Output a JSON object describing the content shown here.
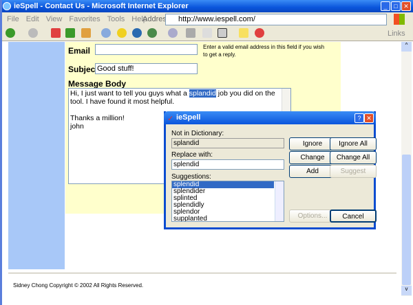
{
  "window": {
    "title": "ieSpell - Contact Us - Microsoft Internet Explorer"
  },
  "menu": [
    "File",
    "Edit",
    "View",
    "Favorites",
    "Tools",
    "Help"
  ],
  "address": {
    "label": "Address",
    "url": "http://www.iespell.com/"
  },
  "links_label": "Links",
  "form": {
    "email_label": "Email",
    "email_value": "",
    "email_hint": "Enter a valid email address in this field if you wish to get a reply.",
    "subject_label": "Subject",
    "subject_value": "Good stuff!",
    "body_label": "Message Body",
    "body_before": "Hi, I just want to tell you guys what a ",
    "body_highlight": "splandid",
    "body_after": " job you did on the tool. I have found it most helpful.",
    "body_line3": "Thanks a million!",
    "body_line4": "john"
  },
  "footer": "Sidney Chong Copyright © 2002 All Rights Reserved.",
  "dialog": {
    "title": "ieSpell",
    "not_in_dict_label": "Not in Dictionary:",
    "not_in_dict_value": "splandid",
    "replace_label": "Replace with:",
    "replace_value": "splendid",
    "suggestions_label": "Suggestions:",
    "suggestions": [
      "splendid",
      "splendider",
      "splinted",
      "splendidly",
      "splendor",
      "supplanted"
    ],
    "selected": "splendid",
    "buttons": {
      "ignore": "Ignore",
      "ignore_all": "Ignore All",
      "change": "Change",
      "change_all": "Change All",
      "add": "Add",
      "suggest": "Suggest",
      "options": "Options...",
      "cancel": "Cancel"
    }
  },
  "colors": {
    "sidebar": "#a8c8f8",
    "form_bg": "#ffffcc",
    "highlight": "#316ac5"
  }
}
